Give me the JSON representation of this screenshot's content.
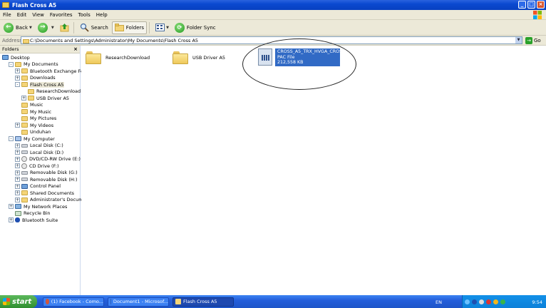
{
  "window": {
    "title": "Flash Cross A5"
  },
  "menu": [
    "File",
    "Edit",
    "View",
    "Favorites",
    "Tools",
    "Help"
  ],
  "toolbar": {
    "back": "Back",
    "search": "Search",
    "folders": "Folders",
    "folder_sync": "Folder Sync"
  },
  "address": {
    "label": "Address",
    "value": "C:\\Documents and Settings\\Administrator\\My Documents\\Flash Cross A5",
    "go": "Go"
  },
  "folders_pane": {
    "title": "Folders",
    "items": [
      {
        "label": "Desktop",
        "depth": 0,
        "exp": "",
        "icon": "desktop"
      },
      {
        "label": "My Documents",
        "depth": 1,
        "exp": "-",
        "icon": "folder"
      },
      {
        "label": "Bluetooth Exchange Folder",
        "depth": 2,
        "exp": "+",
        "icon": "folder"
      },
      {
        "label": "Downloads",
        "depth": 2,
        "exp": "+",
        "icon": "folder"
      },
      {
        "label": "Flash Cross A5",
        "depth": 2,
        "exp": "-",
        "icon": "folder",
        "selected": true
      },
      {
        "label": "ResearchDownload",
        "depth": 3,
        "exp": "",
        "icon": "folder"
      },
      {
        "label": "USB Driver A5",
        "depth": 3,
        "exp": "+",
        "icon": "folder"
      },
      {
        "label": "Music",
        "depth": 2,
        "exp": "",
        "icon": "folder"
      },
      {
        "label": "My Music",
        "depth": 2,
        "exp": "",
        "icon": "folder"
      },
      {
        "label": "My Pictures",
        "depth": 2,
        "exp": "",
        "icon": "folder"
      },
      {
        "label": "My Videos",
        "depth": 2,
        "exp": "+",
        "icon": "folder"
      },
      {
        "label": "Unduhan",
        "depth": 2,
        "exp": "",
        "icon": "folder"
      },
      {
        "label": "My Computer",
        "depth": 1,
        "exp": "-",
        "icon": "computer"
      },
      {
        "label": "Local Disk (C:)",
        "depth": 2,
        "exp": "+",
        "icon": "drive"
      },
      {
        "label": "Local Disk (D:)",
        "depth": 2,
        "exp": "+",
        "icon": "drive"
      },
      {
        "label": "DVD/CD-RW Drive (E:)",
        "depth": 2,
        "exp": "+",
        "icon": "cd"
      },
      {
        "label": "CD Drive (F:)",
        "depth": 2,
        "exp": "+",
        "icon": "cd"
      },
      {
        "label": "Removable Disk (G:)",
        "depth": 2,
        "exp": "+",
        "icon": "drive"
      },
      {
        "label": "Removable Disk (H:)",
        "depth": 2,
        "exp": "+",
        "icon": "drive"
      },
      {
        "label": "Control Panel",
        "depth": 2,
        "exp": "+",
        "icon": "panel"
      },
      {
        "label": "Shared Documents",
        "depth": 2,
        "exp": "+",
        "icon": "folder"
      },
      {
        "label": "Administrator's Documents",
        "depth": 2,
        "exp": "+",
        "icon": "folder"
      },
      {
        "label": "My Network Places",
        "depth": 1,
        "exp": "+",
        "icon": "network"
      },
      {
        "label": "Recycle Bin",
        "depth": 1,
        "exp": "",
        "icon": "recycle"
      },
      {
        "label": "Bluetooth Suite",
        "depth": 1,
        "exp": "+",
        "icon": "bt"
      }
    ]
  },
  "content": {
    "folders": [
      "ResearchDownload",
      "USB Driver A5"
    ],
    "file": {
      "name": "CROSS_A5_TRX_HVGA_CROS...",
      "type": "PAC File",
      "size": "212,558 KB"
    }
  },
  "taskbar": {
    "start": "start",
    "tasks": [
      "(1) Facebook - Como...",
      "Document1 - Microsof...",
      "Flash Cross A5"
    ],
    "lang": "EN",
    "clock": "9:54"
  }
}
